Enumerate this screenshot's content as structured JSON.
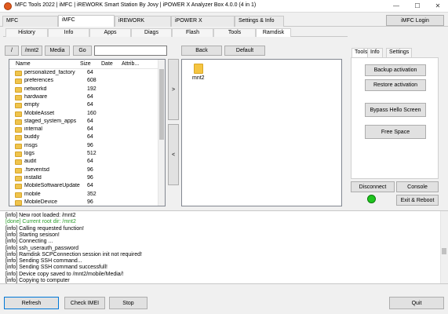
{
  "window": {
    "title": "MFC Tools 2022 | iMFC | iREWORK Smart Station By Jovy | iPOWER X Analyzer Box 4.0.0 (4 in 1)",
    "minimize_glyph": "—",
    "maximize_glyph": "☐",
    "close_glyph": "✕"
  },
  "top_tabs": [
    "MFC",
    "iMFC",
    "iREWORK",
    "iPOWER X",
    "Settings & Info"
  ],
  "imfc_login_label": "iMFC Login",
  "sub_tabs": [
    "History",
    "Info",
    "Apps",
    "Diags",
    "Flash",
    "Tools",
    "Ramdisk"
  ],
  "nav": {
    "slash": "/",
    "mnt2": "/mnt2",
    "media": "Media",
    "go": "Go",
    "path_value": "",
    "back": "Back",
    "default": "Default"
  },
  "file_list": {
    "headers": [
      "Name",
      "Size",
      "Date",
      "Attrib..."
    ],
    "rows": [
      {
        "name": "personalized_factory",
        "size": "64"
      },
      {
        "name": "preferences",
        "size": "608"
      },
      {
        "name": "networkd",
        "size": "192"
      },
      {
        "name": "hardware",
        "size": "64"
      },
      {
        "name": "empty",
        "size": "64"
      },
      {
        "name": "MobileAsset",
        "size": "160"
      },
      {
        "name": "staged_system_apps",
        "size": "64"
      },
      {
        "name": "internal",
        "size": "64"
      },
      {
        "name": "buddy",
        "size": "64"
      },
      {
        "name": "msgs",
        "size": "96"
      },
      {
        "name": "logs",
        "size": "512"
      },
      {
        "name": "audit",
        "size": "64"
      },
      {
        "name": ".fseventsd",
        "size": "96"
      },
      {
        "name": "installd",
        "size": "96"
      },
      {
        "name": "MobileSoftwareUpdate",
        "size": "64"
      },
      {
        "name": "mobile",
        "size": "352"
      },
      {
        "name": "MobileDevice",
        "size": "96"
      }
    ]
  },
  "transfer": {
    "right": ">",
    "left": "<"
  },
  "remote_panel": {
    "folder_label": "mnt2"
  },
  "right_tabs": [
    "Tools",
    "Info",
    "Settings"
  ],
  "tools": {
    "backup_activation": "Backup activation",
    "restore_activation": "Restore activation",
    "bypass_hello": "Bypass Hello Screen",
    "free_space": "Free Space"
  },
  "connection": {
    "disconnect": "Disconnect",
    "console": "Console",
    "exit_reboot": "Exit & Reboot",
    "status_color": "#1fc51f"
  },
  "log_lines": [
    {
      "text": "[info] New root loaded: /mnt2",
      "color": "#000000"
    },
    {
      "text": "[done] Current root dir: /mnt2",
      "color": "#2e9e2e"
    },
    {
      "text": "[info] Calling requested function!",
      "color": "#000000"
    },
    {
      "text": "[info] Starting sesison!",
      "color": "#000000"
    },
    {
      "text": "[info] Connecting ...",
      "color": "#000000"
    },
    {
      "text": "[info] ssh_userauth_password",
      "color": "#000000"
    },
    {
      "text": "[info] Ramdisk SCPConnection session init not required!",
      "color": "#000000"
    },
    {
      "text": "[info] Sending SSH command...",
      "color": "#000000"
    },
    {
      "text": "[info] Sending SSH command successfull!",
      "color": "#000000"
    },
    {
      "text": "[info] Device copy saved to /mnt2/mobile/Media/!",
      "color": "#000000"
    },
    {
      "text": "[info] Copying to computer",
      "color": "#000000"
    }
  ],
  "bottom": {
    "refresh": "Refresh",
    "check_imei": "Check IMEI",
    "stop": "Stop",
    "quit": "Quit"
  }
}
